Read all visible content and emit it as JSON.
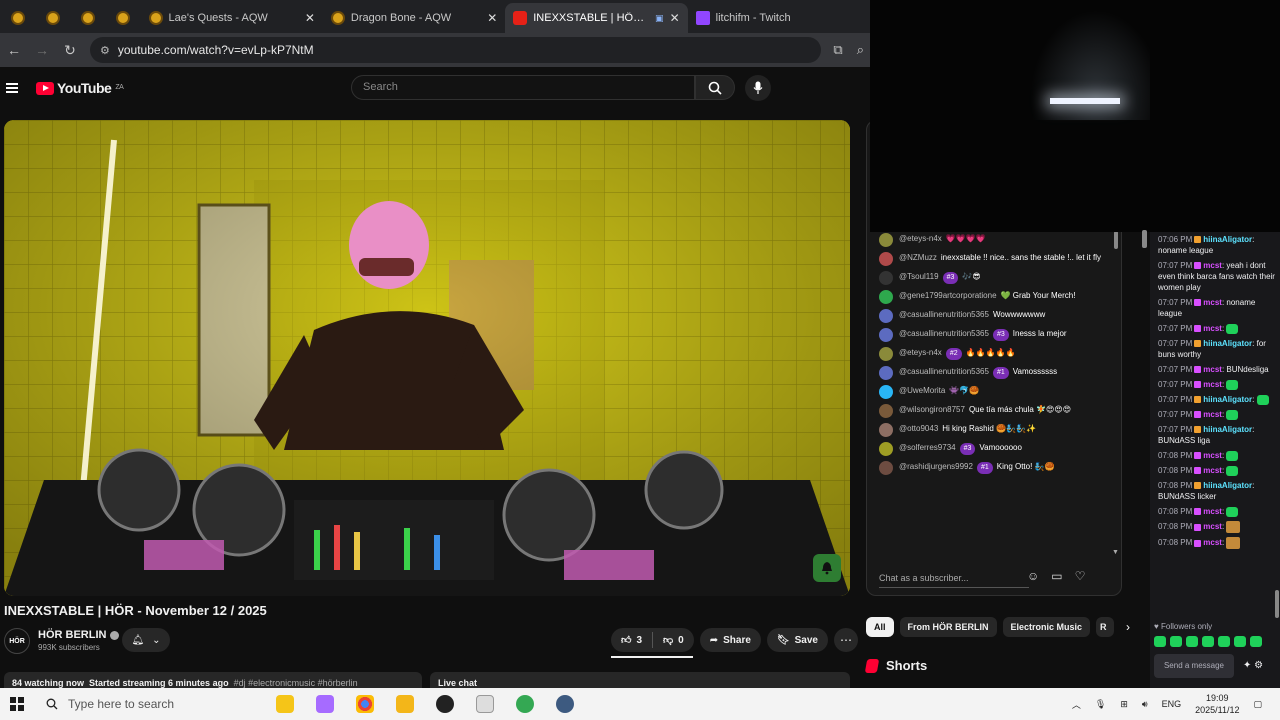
{
  "tabs": [
    {
      "label": "",
      "kind": "aqw"
    },
    {
      "label": "",
      "kind": "aqw"
    },
    {
      "label": "",
      "kind": "aqw"
    },
    {
      "label": "",
      "kind": "aqw"
    },
    {
      "label": "Lae's Quests - AQW",
      "kind": "aqw"
    },
    {
      "label": "Dragon Bone - AQW",
      "kind": "aqw"
    },
    {
      "label": "INEXXSTABLE | HÖR - Nove",
      "kind": "youtube",
      "active": true
    },
    {
      "label": "litchifm - Twitch",
      "kind": "twitch"
    }
  ],
  "address": {
    "url": "youtube.com/watch?v=evLp-kP7NtM"
  },
  "youtube": {
    "logo": "YouTube",
    "region": "ZA",
    "search_placeholder": "Search"
  },
  "video": {
    "title": "INEXXSTABLE | HÖR - November 12 / 2025",
    "channel": "HÖR BERLIN",
    "channel_avatar": "HÖR",
    "subscribers": "993K subscribers",
    "likes": "3",
    "dislikes": "0",
    "share": "Share",
    "save": "Save",
    "watching": "84 watching now",
    "started": "Started streaming 6 minutes ago",
    "tags": "#dj #electronicmusic #hörberlin",
    "live_chat_label": "Live chat"
  },
  "yt_chat": {
    "messages": [
      {
        "author": "@eteys-n4x",
        "badge": "",
        "text": "💗💗💗💗",
        "avatar_color": "#8a8a3a"
      },
      {
        "author": "@NZMuzz",
        "badge": "",
        "text": "inexxstable !! nice.. sans the stable !.. let it fly",
        "avatar_color": "#b04a4a"
      },
      {
        "author": "@Tsoul119",
        "badge": "#3",
        "text": "🎶😎",
        "avatar_color": "#333"
      },
      {
        "author": "@gene1799artcorporatione",
        "badge": "",
        "text": "💚 Grab Your Merch!",
        "avatar_color": "#2ea84d"
      },
      {
        "author": "@casuallinenutrition5365",
        "badge": "",
        "text": "Wowwwwwww",
        "avatar_color": "#5c6bc0"
      },
      {
        "author": "@casuallinenutrition5365",
        "badge": "#3",
        "text": "Inesss la mejor",
        "avatar_color": "#5c6bc0"
      },
      {
        "author": "@eteys-n4x",
        "badge": "#2",
        "text": "🔥🔥🔥🔥🔥",
        "avatar_color": "#8a8a3a"
      },
      {
        "author": "@casuallinenutrition5365",
        "badge": "#1",
        "text": "Vamossssss",
        "avatar_color": "#5c6bc0"
      },
      {
        "author": "@UweMorita",
        "badge": "",
        "text": "👾🐬🥮",
        "avatar_color": "#29b6f6"
      },
      {
        "author": "@wilsongiron8757",
        "badge": "",
        "text": "Que tía más chula 🧚😍😍😍",
        "avatar_color": "#7a5a3a"
      },
      {
        "author": "@otto9043",
        "badge": "",
        "text": "Hi king Rashid 🥮🧞🧞✨",
        "avatar_color": "#8d6e63"
      },
      {
        "author": "@solferres9734",
        "badge": "#3",
        "text": "Vamoooooo",
        "avatar_color": "#9e9d24"
      },
      {
        "author": "@rashidjurgens9992",
        "badge": "#1",
        "text": "King Otto! 🧞🥮",
        "avatar_color": "#6d4c41"
      }
    ],
    "input_placeholder": "Chat as a subscriber..."
  },
  "chips": {
    "items": [
      "All",
      "From HÖR BERLIN",
      "Electronic Music",
      "R"
    ]
  },
  "shorts_label": "Shorts",
  "twitch": {
    "messages": [
      {
        "time": "07:06 PM",
        "user": "hiinaAligator",
        "text": "noname league",
        "color": "cyan"
      },
      {
        "time": "07:07 PM",
        "user": "mcst",
        "text": "yeah i dont even think barca fans watch their women play",
        "color": "pink"
      },
      {
        "time": "07:07 PM",
        "user": "mcst",
        "text": "noname league",
        "color": "pink"
      },
      {
        "time": "07:07 PM",
        "user": "mcst",
        "text": "",
        "emote": true,
        "color": "pink"
      },
      {
        "time": "07:07 PM",
        "user": "hiinaAligator",
        "text": "for buns worthy",
        "color": "cyan"
      },
      {
        "time": "07:07 PM",
        "user": "mcst",
        "text": "BUNdesliga",
        "color": "pink"
      },
      {
        "time": "07:07 PM",
        "user": "mcst",
        "text": "",
        "emote": true,
        "color": "pink"
      },
      {
        "time": "07:07 PM",
        "user": "hiinaAligator",
        "text": "",
        "emote": true,
        "color": "cyan"
      },
      {
        "time": "07:07 PM",
        "user": "mcst",
        "text": "",
        "emote": true,
        "color": "pink"
      },
      {
        "time": "07:07 PM",
        "user": "hiinaAligator",
        "text": "BUNdASS liga",
        "color": "cyan"
      },
      {
        "time": "07:08 PM",
        "user": "mcst",
        "text": "",
        "emote": true,
        "color": "pink"
      },
      {
        "time": "07:08 PM",
        "user": "mcst",
        "text": "",
        "emote": true,
        "color": "pink"
      },
      {
        "time": "07:08 PM",
        "user": "hiinaAligator",
        "text": "BUNdASS licker",
        "color": "cyan"
      },
      {
        "time": "07:08 PM",
        "user": "mcst",
        "text": "",
        "emote": true,
        "color": "pink"
      },
      {
        "time": "07:08 PM",
        "user": "mcst",
        "text": "",
        "cat": true,
        "color": "pink"
      },
      {
        "time": "07:08 PM",
        "user": "mcst",
        "text": "",
        "cat": true,
        "color": "pink"
      }
    ],
    "followers_only": "Followers only",
    "input_placeholder": "Send a message"
  },
  "taskbar": {
    "search_placeholder": "Type here to search",
    "lang": "ENG",
    "time": "19:09",
    "date": "2025/11/12"
  },
  "colors": {
    "yt_red": "#ff0033",
    "twitch_purple": "#9146ff",
    "video_yellow": "#c9c015"
  }
}
